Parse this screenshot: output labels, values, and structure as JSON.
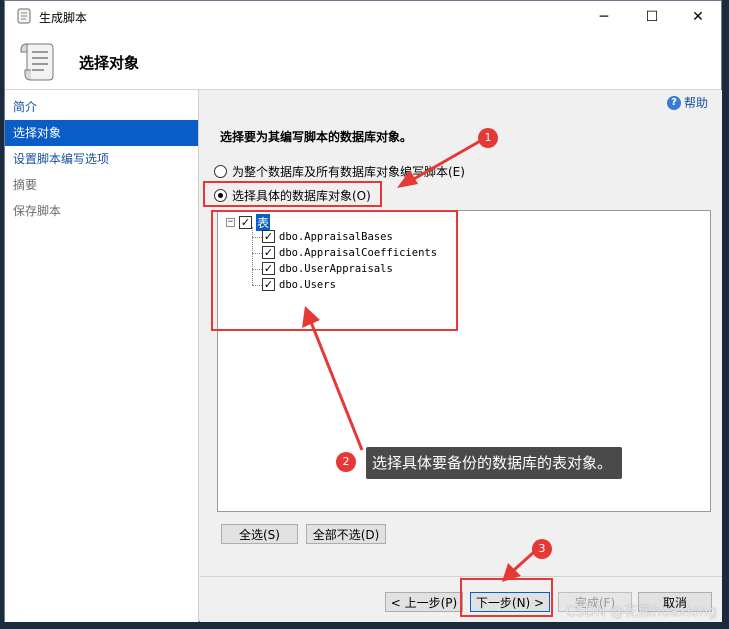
{
  "window": {
    "title": "生成脚本",
    "minimize_glyph": "─",
    "maximize_glyph": "☐",
    "close_glyph": "✕"
  },
  "header": {
    "title": "选择对象"
  },
  "sidebar": {
    "items": [
      {
        "label": "简介"
      },
      {
        "label": "选择对象"
      },
      {
        "label": "设置脚本编写选项"
      },
      {
        "label": "摘要"
      },
      {
        "label": "保存脚本"
      }
    ]
  },
  "main": {
    "help_label": "帮助",
    "instruction": "选择要为其编写脚本的数据库对象。",
    "radio_all": "为整个数据库及所有数据库对象编写脚本(E)",
    "radio_specific": "选择具体的数据库对象(O)",
    "tree": {
      "root_label": "表",
      "root_expander": "−",
      "tables": [
        {
          "name": "dbo.AppraisalBases",
          "checked": true
        },
        {
          "name": "dbo.AppraisalCoefficients",
          "checked": true
        },
        {
          "name": "dbo.UserAppraisals",
          "checked": true
        },
        {
          "name": "dbo.Users",
          "checked": true
        }
      ]
    },
    "select_all_label": "全选(S)",
    "deselect_all_label": "全部不选(D)"
  },
  "footer": {
    "prev_label": "< 上一步(P)",
    "next_label": "下一步(N) >",
    "finish_label": "完成(F)",
    "cancel_label": "取消"
  },
  "annotations": {
    "marker_1": "1",
    "marker_2": "2",
    "marker_3": "3",
    "callout_text": "选择具体要备份的数据库的表对象。",
    "color": "#e53935"
  },
  "watermark": "CSDN @花熊huaxiong"
}
